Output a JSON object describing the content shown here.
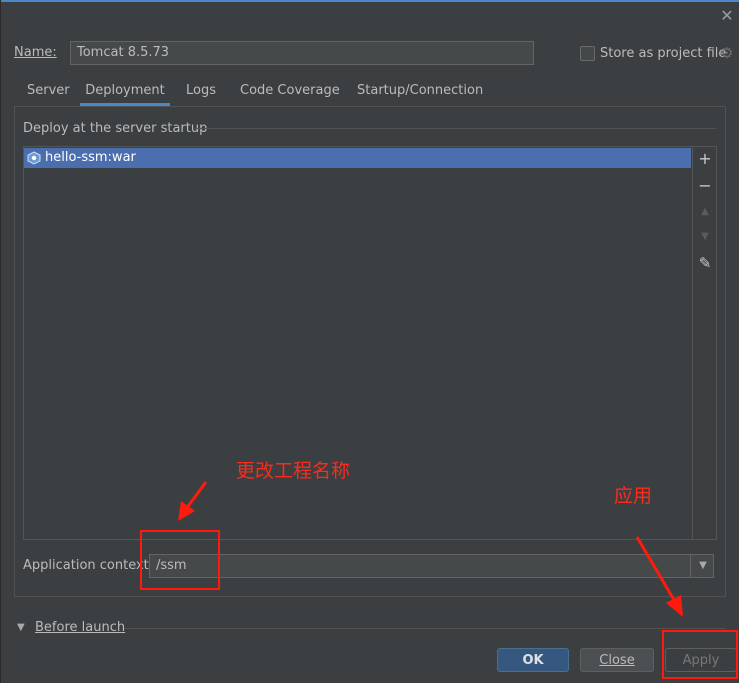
{
  "dialog": {
    "name_label": "Name:",
    "name_value": "Tomcat 8.5.73",
    "store_label": "Store as project file",
    "close_glyph": "✕"
  },
  "tabs": [
    {
      "label": "Server"
    },
    {
      "label": "Deployment"
    },
    {
      "label": "Logs"
    },
    {
      "label": "Code Coverage"
    },
    {
      "label": "Startup/Connection"
    }
  ],
  "deployment": {
    "section_title": "Deploy at the server startup",
    "artifacts": [
      {
        "label": "hello-ssm:war"
      }
    ],
    "side_buttons": {
      "add": "+",
      "remove": "−",
      "up": "▲",
      "down": "▼",
      "edit": "✎"
    },
    "app_context_label": "Application context:",
    "app_context_value": "/ssm"
  },
  "before_launch": {
    "label": "Before launch"
  },
  "buttons": {
    "ok": "OK",
    "close": "Close",
    "apply": "Apply"
  },
  "annotations": {
    "rename": "更改工程名称",
    "apply": "应用",
    "color": "#ff1a0d"
  },
  "colors": {
    "accent": "#4a88c7",
    "selection": "#4b6eaf",
    "background": "#3c3f41"
  }
}
